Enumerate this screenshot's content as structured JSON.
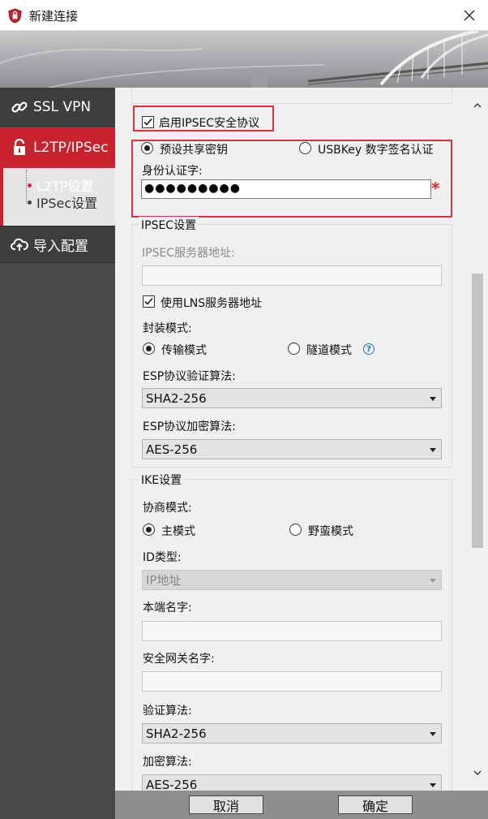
{
  "window": {
    "title": "新建连接"
  },
  "sidebar": {
    "items": [
      {
        "label": "SSL VPN",
        "icon": "link-icon"
      },
      {
        "label": "L2TP/IPSec",
        "icon": "unlock-icon"
      },
      {
        "label": "导入配置",
        "icon": "cloud-upload-icon"
      }
    ],
    "subitems": [
      {
        "label": "L2TP设置"
      },
      {
        "label": "IPSec设置"
      }
    ]
  },
  "main": {
    "enable_ipsec_label": "启用IPSEC安全协议",
    "auth": {
      "psk_label": "预设共享密钥",
      "usbkey_label": "USBKey 数字签名认证",
      "identity_label": "身份认证字:",
      "password_mask": "●●●●●●●●●",
      "required_mark": "*"
    },
    "ipsec": {
      "title": "IPSEC设置",
      "server_label": "IPSEC服务器地址:",
      "server_value": "",
      "use_lns_label": "使用LNS服务器地址",
      "encap_label": "封装模式:",
      "transport_label": "传输模式",
      "tunnel_label": "隧道模式",
      "help_glyph": "?",
      "esp_auth_label": "ESP协议验证算法:",
      "esp_auth_value": "SHA2-256",
      "esp_enc_label": "ESP协议加密算法:",
      "esp_enc_value": "AES-256"
    },
    "ike": {
      "title": "IKE设置",
      "negotiation_label": "协商模式:",
      "main_mode_label": "主模式",
      "aggressive_label": "野蛮模式",
      "id_type_label": "ID类型:",
      "id_type_value": "IP地址",
      "local_name_label": "本端名字:",
      "gateway_name_label": "安全网关名字:",
      "auth_alg_label": "验证算法:",
      "auth_alg_value": "SHA2-256",
      "enc_alg_label": "加密算法:",
      "enc_alg_value": "AES-256"
    }
  },
  "buttons": {
    "cancel": "取消",
    "ok": "确定"
  },
  "colors": {
    "accent_red": "#c8222d",
    "sidebar_bg": "#4a4a4a",
    "highlight_box": "#e0313c"
  }
}
